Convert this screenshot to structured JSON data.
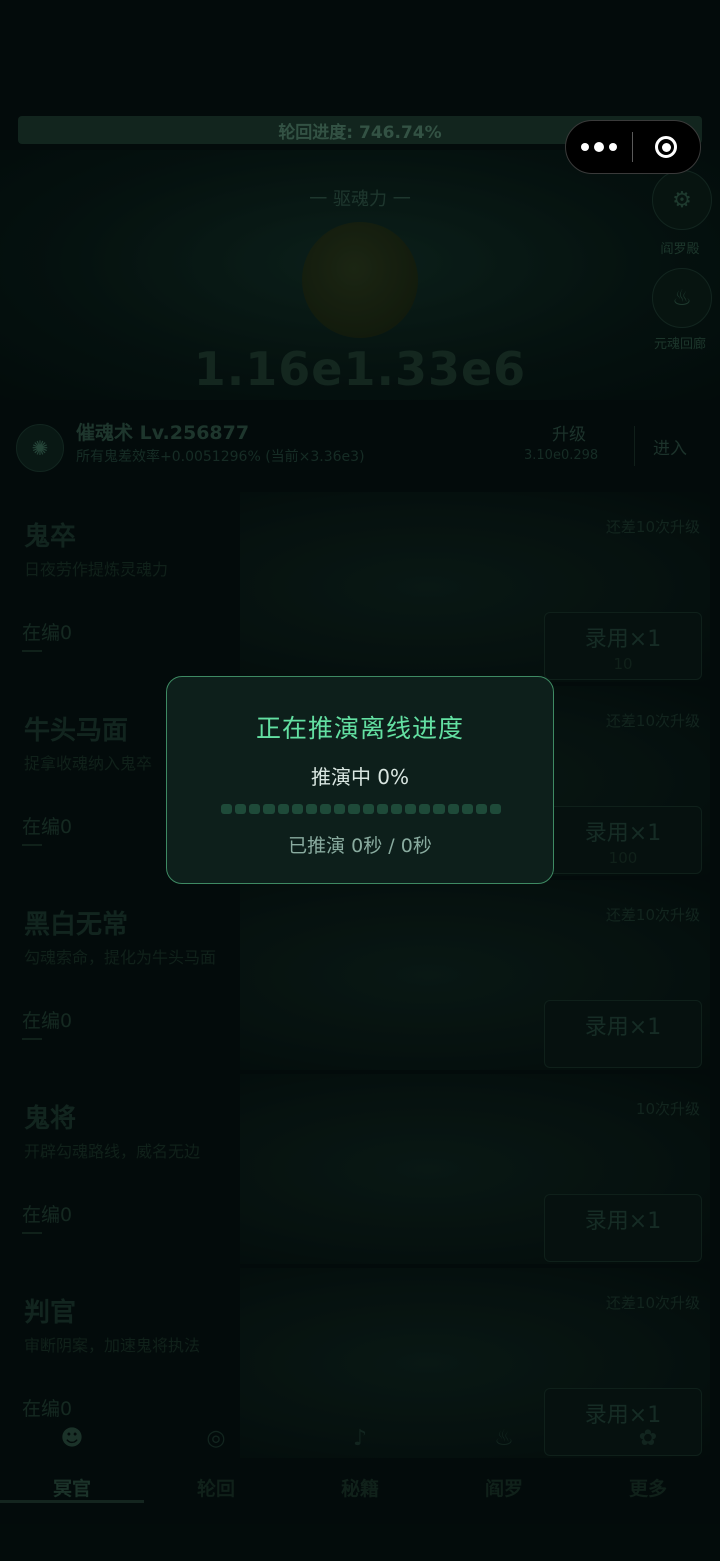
{
  "banner": {
    "cycle_progress": "轮回进度: 746.74%"
  },
  "hero": {
    "subtitle": "一 驱魂力 一",
    "value": "1.16e1.33e6",
    "side_buttons": [
      {
        "icon": "altar-icon",
        "label": "阎罗殿"
      },
      {
        "icon": "flame-icon",
        "label": "元魂回廊"
      }
    ]
  },
  "skill": {
    "name": "催魂术 Lv.256877",
    "desc": "所有鬼差效率+0.0051296% (当前×3.36e3)",
    "upgrade_label": "升级",
    "upgrade_cost": "3.10e0.298",
    "enter_label": "进入"
  },
  "cards": [
    {
      "title": "鬼卒",
      "desc": "日夜劳作提炼灵魂力",
      "hint": "还差10次升级",
      "count": "在编0",
      "recruit": "录用×1",
      "cost": "10"
    },
    {
      "title": "牛头马面",
      "desc": "捉拿收魂纳入鬼卒",
      "hint": "还差10次升级",
      "count": "在编0",
      "recruit": "录用×1",
      "cost": "100"
    },
    {
      "title": "黑白无常",
      "desc": "勾魂索命，提化为牛头马面",
      "hint": "还差10次升级",
      "count": "在编0",
      "recruit": "录用×1",
      "cost": ""
    },
    {
      "title": "鬼将",
      "desc": "开辟勾魂路线，威名无边",
      "hint": "10次升级",
      "count": "在编0",
      "recruit": "录用×1",
      "cost": ""
    },
    {
      "title": "判官",
      "desc": "审断阴案，加速鬼将执法",
      "hint": "还差10次升级",
      "count": "在编0",
      "recruit": "录用×1",
      "cost": ""
    }
  ],
  "nav": {
    "items": [
      {
        "label": "冥官",
        "icon": "ghost-icon",
        "active": true
      },
      {
        "label": "轮回",
        "icon": "wheel-icon",
        "active": false
      },
      {
        "label": "秘籍",
        "icon": "book-icon",
        "active": false
      },
      {
        "label": "阎罗",
        "icon": "fire-icon",
        "active": false
      },
      {
        "label": "更多",
        "icon": "more-icon",
        "active": false
      }
    ]
  },
  "modal": {
    "title": "正在推演离线进度",
    "status": "推演中 0%",
    "progress": 0,
    "elapsed": "已推演 0秒 / 0秒"
  },
  "colors": {
    "accent": "#63e0a2",
    "modal_border": "#3e8a63",
    "background": "#051211"
  }
}
